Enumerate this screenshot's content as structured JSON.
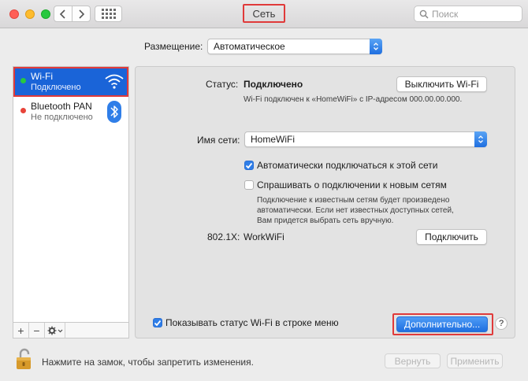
{
  "window": {
    "title": "Сеть",
    "search_placeholder": "Поиск"
  },
  "location": {
    "label": "Размещение:",
    "value": "Автоматическое"
  },
  "services": [
    {
      "name": "Wi-Fi",
      "status": "Подключено",
      "dot_color": "#28c840",
      "selected": true
    },
    {
      "name": "Bluetooth PAN",
      "status": "Не подключено",
      "dot_color": "#e8443a",
      "selected": false
    }
  ],
  "sidebar_toolbar": {
    "add": "+",
    "remove": "−"
  },
  "wifi": {
    "status_label": "Статус:",
    "status_value": "Подключено",
    "turn_off_button": "Выключить Wi-Fi",
    "status_detail": "Wi-Fi подключен к «HomeWiFi» с IP-адресом 000.00.00.000.",
    "network_label": "Имя сети:",
    "network_value": "HomeWiFi",
    "auto_join_label": "Автоматически подключаться к этой сети",
    "auto_join_checked": true,
    "ask_join_label": "Спрашивать о подключении к новым сетям",
    "ask_join_checked": false,
    "ask_join_note": "Подключение к известным сетям будет произведено автоматически. Если нет известных доступных сетей, Вам придется выбрать сеть вручную.",
    "dot1x_label": "802.1X:",
    "dot1x_value": "WorkWiFi",
    "connect_button": "Подключить",
    "show_status_label": "Показывать статус Wi-Fi в строке меню",
    "show_status_checked": true,
    "advanced_button": "Дополнительно...",
    "help_button": "?"
  },
  "footer": {
    "lock_text": "Нажмите на замок, чтобы запретить изменения.",
    "revert_button": "Вернуть",
    "apply_button": "Применить"
  },
  "colors": {
    "accent": "#1a64d8",
    "highlight": "#e03a3a"
  }
}
